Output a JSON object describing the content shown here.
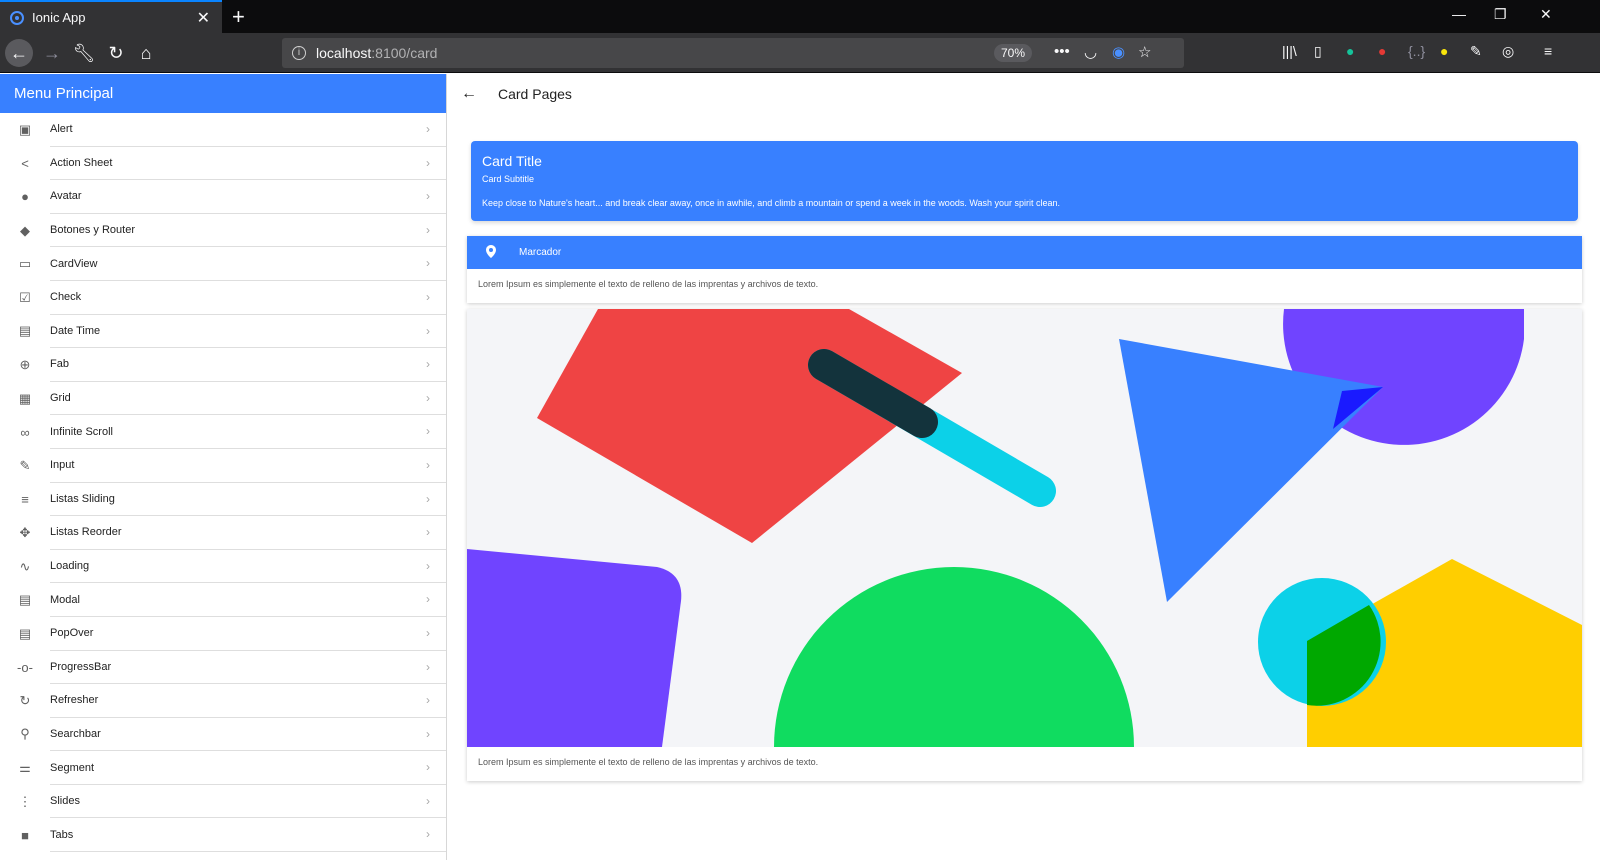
{
  "browser": {
    "tab_title": "Ionic App",
    "url_host": "localhost",
    "url_path": ":8100/card",
    "zoom": "70%"
  },
  "sidebar": {
    "title": "Menu Principal",
    "items": [
      {
        "label": "Alert",
        "icon": "alert-icon"
      },
      {
        "label": "Action Sheet",
        "icon": "share-icon"
      },
      {
        "label": "Avatar",
        "icon": "person-icon"
      },
      {
        "label": "Botones y Router",
        "icon": "cube-icon"
      },
      {
        "label": "CardView",
        "icon": "card-icon"
      },
      {
        "label": "Check",
        "icon": "checkbox-icon"
      },
      {
        "label": "Date Time",
        "icon": "calendar-icon"
      },
      {
        "label": "Fab",
        "icon": "add-circle-icon"
      },
      {
        "label": "Grid",
        "icon": "grid-icon"
      },
      {
        "label": "Infinite Scroll",
        "icon": "infinite-icon"
      },
      {
        "label": "Input",
        "icon": "pencil-icon"
      },
      {
        "label": "Listas Sliding",
        "icon": "list-icon"
      },
      {
        "label": "Listas Reorder",
        "icon": "move-icon"
      },
      {
        "label": "Loading",
        "icon": "pulse-icon"
      },
      {
        "label": "Modal",
        "icon": "copy-icon"
      },
      {
        "label": "PopOver",
        "icon": "document-icon"
      },
      {
        "label": "ProgressBar",
        "icon": "git-commit-icon"
      },
      {
        "label": "Refresher",
        "icon": "sync-icon"
      },
      {
        "label": "Searchbar",
        "icon": "search-icon"
      },
      {
        "label": "Segment",
        "icon": "options-icon"
      },
      {
        "label": "Slides",
        "icon": "more-vertical-icon"
      },
      {
        "label": "Tabs",
        "icon": "square-icon"
      }
    ]
  },
  "page": {
    "title": "Card Pages"
  },
  "card1": {
    "title": "Card Title",
    "subtitle": "Card Subtitle",
    "content": "Keep close to Nature's heart... and break clear away, once in awhile, and climb a mountain or spend a week in the woods. Wash your spirit clean."
  },
  "card2": {
    "item_label": "Marcador",
    "body": "Lorem Ipsum es simplemente el texto de relleno de las imprentas y archivos de texto."
  },
  "card3": {
    "body": "Lorem Ipsum es simplemente el texto de relleno de las imprentas y archivos de texto."
  },
  "colors": {
    "primary": "#3880ff",
    "red": "#ef4444",
    "purple": "#7044ff",
    "green": "#10dc60",
    "cyan": "#0cd1e8",
    "yellow": "#ffce00",
    "blue": "#3880ff"
  }
}
